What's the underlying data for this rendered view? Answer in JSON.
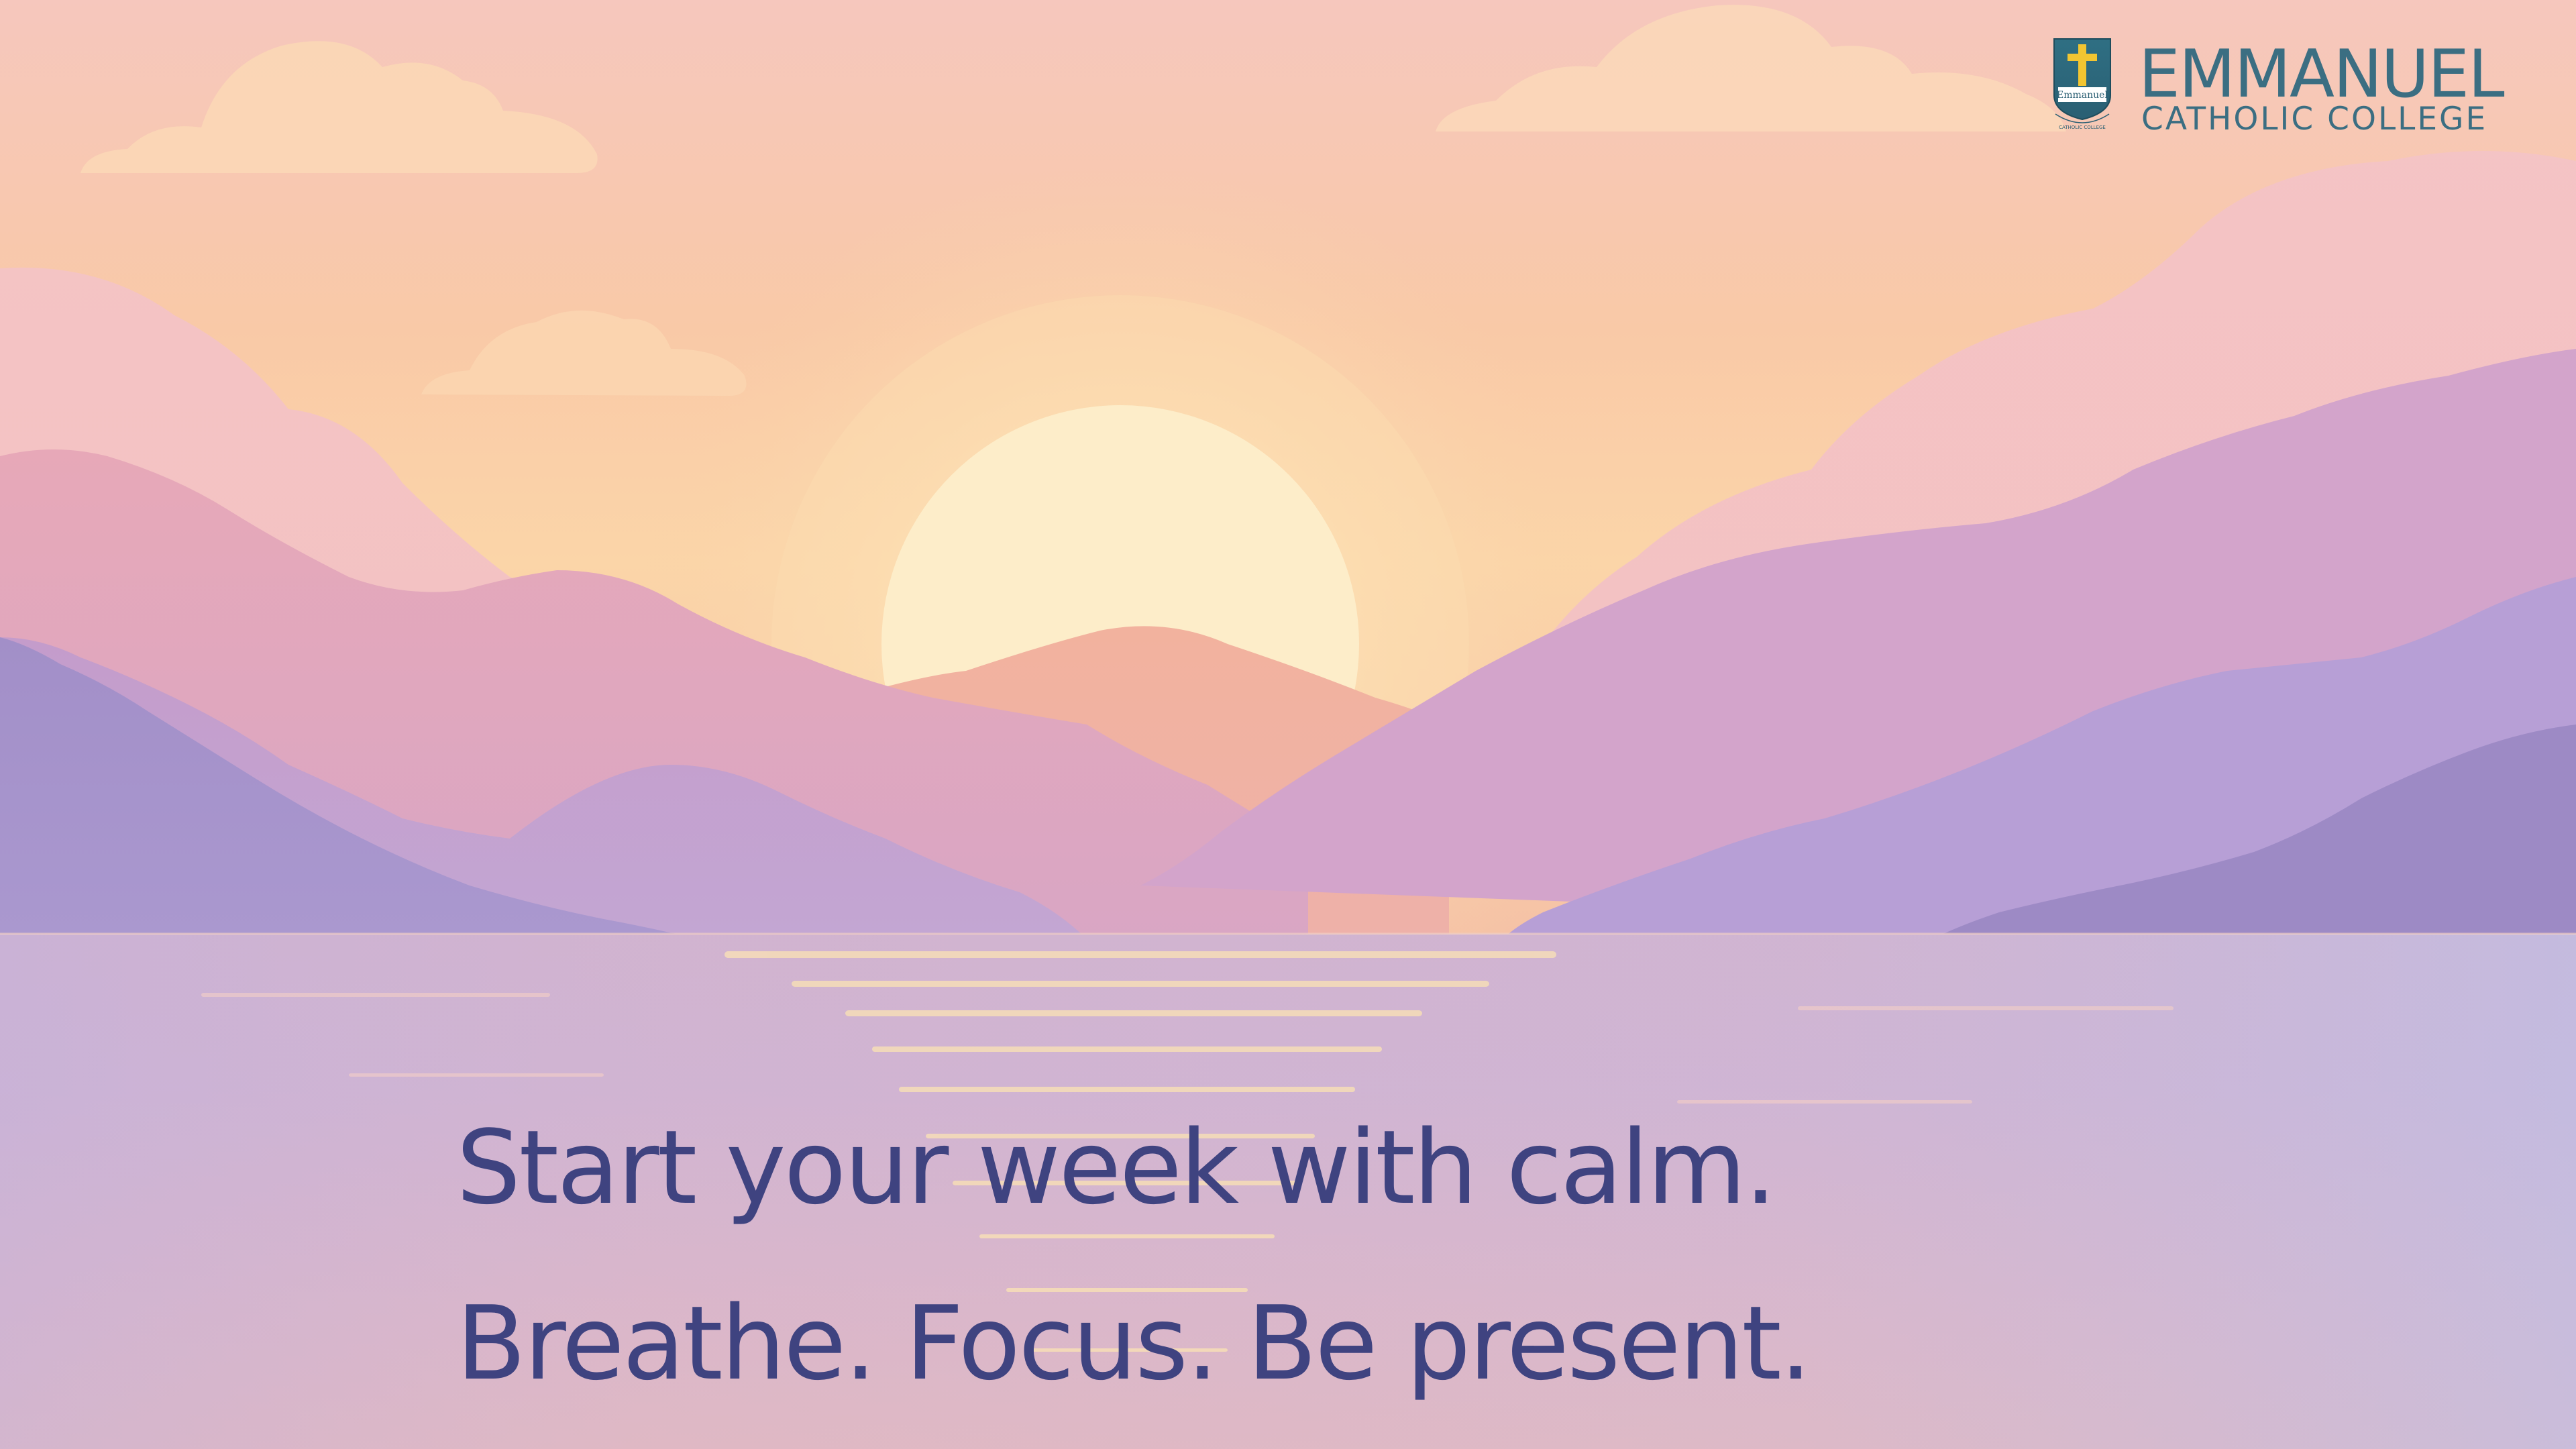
{
  "logo": {
    "name": "EMMANUEL",
    "subtitle": "CATHOLIC COLLEGE",
    "crest_text": "Emmanuel",
    "crest_ring_text": "CATHOLIC COLLEGE",
    "icon": "school-crest-cross",
    "color": "#3b6e82"
  },
  "message": {
    "line1": "Start your week with calm.",
    "line2": "Breathe. Focus. Be present.",
    "color": "#3f4380"
  },
  "scene": {
    "description_icon": "sunset-mountains-lake",
    "sky_top": "#f8cdb7",
    "sun_color": "#fdeccb",
    "mountain_color": "#9c8ac8",
    "water_color": "#d4b6d6"
  }
}
